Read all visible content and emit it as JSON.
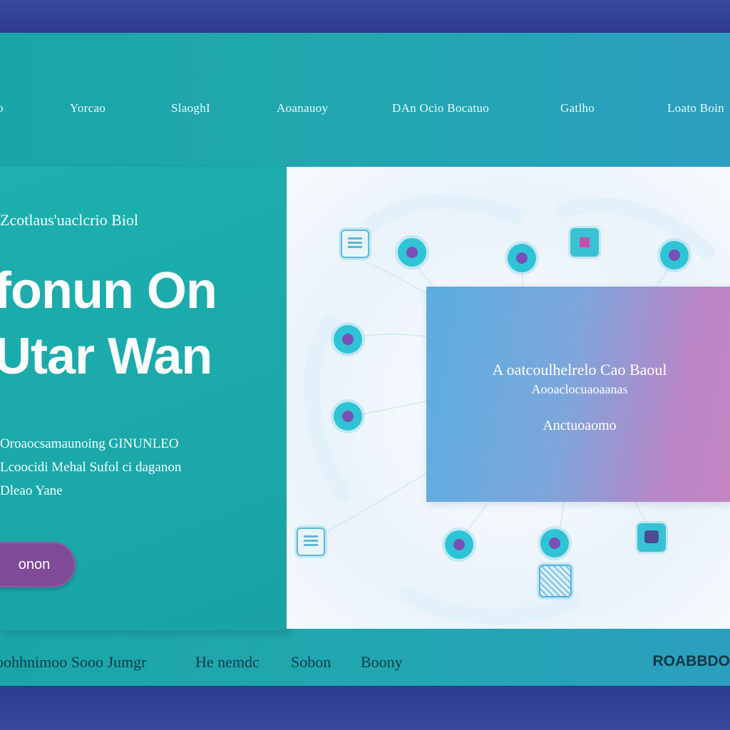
{
  "nav": {
    "items": [
      "o",
      "Yorcao",
      "SlaoghI",
      "Aoanauoy",
      "DAn Ocio Bocatuo",
      "Gatlho",
      "Loato Boin"
    ]
  },
  "hero": {
    "kicker": "Zcotlaus'uaclcrio Biol",
    "kicker_mark": "\\",
    "title_line1": "fonun On",
    "title_line2": "Utar Wan",
    "desc_line1": "Oroaocsamaunoing GINUNLEO",
    "desc_line2": "Lcoocidi Mehal Sufol ci daganon",
    "desc_line3": "Dleao Yane",
    "cta_label": "onon"
  },
  "card": {
    "line1": "A oatcoulhelrelo Cao Baoul",
    "line2": "Aooaclocuaoaanas",
    "line3": "Anctuoaomo"
  },
  "footer": {
    "items": [
      "oohhnimoo Sooo Jumgr",
      "He nemdc",
      "Sobon",
      "Boony"
    ],
    "brand": "ROABBDO"
  },
  "colors": {
    "teal": "#1aa6a8",
    "navy": "#2b3a86",
    "cta": "#7f4a97",
    "node": "#2ec4d6"
  }
}
